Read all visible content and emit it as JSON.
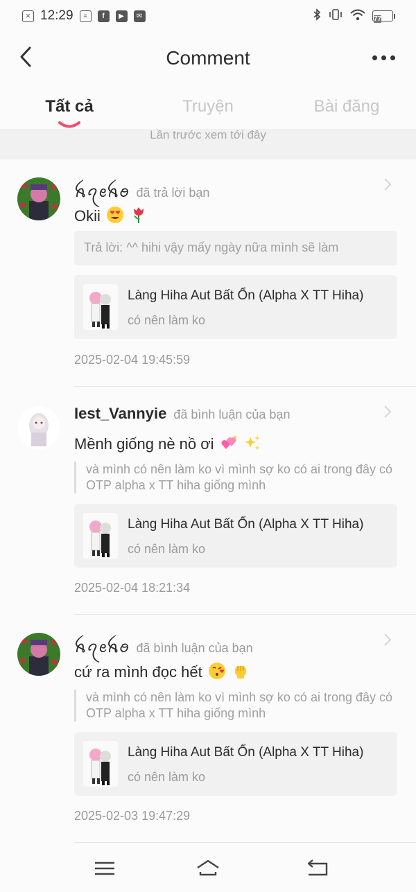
{
  "status_bar": {
    "time": "12:29",
    "battery": "77"
  },
  "header": {
    "title": "Comment"
  },
  "tabs": [
    {
      "label": "Tất cả",
      "active": true
    },
    {
      "label": "Truyện",
      "active": false
    },
    {
      "label": "Bài đăng",
      "active": false
    }
  ],
  "last_viewed": "Lần trước xem tới đây",
  "items": [
    {
      "user": "ꫝꪖꫀꫝꪮ",
      "action": "đã trả lời bạn",
      "text": "Okii",
      "emojis": [
        "heart-eyes",
        "tulip"
      ],
      "reply": "Trả lời: ^^ hihi vậy mấy ngày nữa mình sẽ làm",
      "card_title": "Làng Hiha Aut Bất Ổn (Alpha X TT Hiha)",
      "card_sub": "có nên làm ko",
      "time": "2025-02-04 19:45:59"
    },
    {
      "user": "Iest_Vannyie",
      "action": "đã bình luận của bạn",
      "text": "Mềnh giống nè nồ ơi",
      "emojis": [
        "sparkling-hearts",
        "sparkles"
      ],
      "quote": "và mình có nên làm ko vì mình sợ ko có ai trong đây có OTP alpha x TT hiha giống mình",
      "card_title": "Làng Hiha Aut Bất Ổn (Alpha X TT Hiha)",
      "card_sub": "có nên làm ko",
      "time": "2025-02-04 18:21:34"
    },
    {
      "user": "ꫝꪖꫀꫝꪮ",
      "action": "đã bình luận của bạn",
      "text": "cứ ra mình đọc hết",
      "emojis": [
        "kissing-heart",
        "fist"
      ],
      "quote": "và mình có nên làm ko vì mình sợ ko có ai trong đây có OTP alpha x TT hiha giống mình",
      "card_title": "Làng Hiha Aut Bất Ổn (Alpha X TT Hiha)",
      "card_sub": "có nên làm ko",
      "time": "2025-02-03 19:47:29"
    }
  ],
  "colors": {
    "accent": "#f0506e",
    "muted": "#9b9b9b",
    "card_bg": "#f1f1f1"
  }
}
